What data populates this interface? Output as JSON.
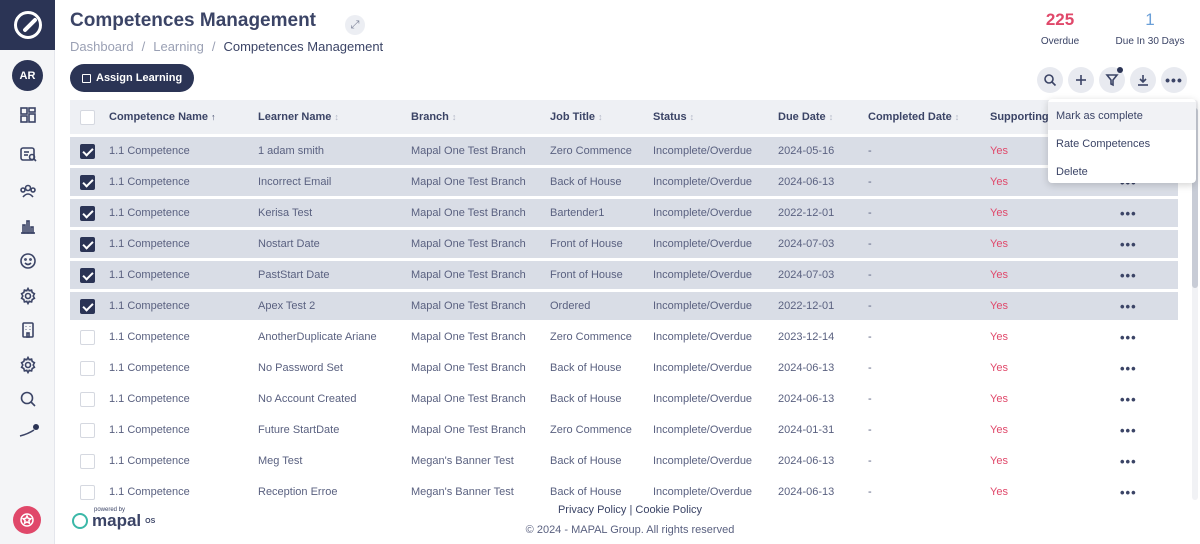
{
  "sidebar": {
    "avatar_initials": "AR"
  },
  "header": {
    "title": "Competences Management",
    "breadcrumb": [
      "Dashboard",
      "Learning",
      "Competences Management"
    ],
    "stats": [
      {
        "value": "225",
        "label": "Overdue",
        "color": "#e0486a"
      },
      {
        "value": "1",
        "label": "Due In 30 Days",
        "color": "#6a9fd8"
      }
    ]
  },
  "toolbar": {
    "assign_label": "Assign Learning",
    "more_label": "•••"
  },
  "table": {
    "columns": [
      "Competence Name",
      "Learner Name",
      "Branch",
      "Job Title",
      "Status",
      "Due Date",
      "Completed Date",
      "Supporting"
    ],
    "rows": [
      {
        "selected": true,
        "cells": [
          "1.1 Competence",
          "1 adam smith",
          "Mapal One Test Branch",
          "Zero Commence",
          "Incomplete/Overdue",
          "2024-05-16",
          "-",
          "Yes"
        ]
      },
      {
        "selected": true,
        "cells": [
          "1.1 Competence",
          "Incorrect Email",
          "Mapal One Test Branch",
          "Back of House",
          "Incomplete/Overdue",
          "2024-06-13",
          "-",
          "Yes"
        ]
      },
      {
        "selected": true,
        "cells": [
          "1.1 Competence",
          "Kerisa Test",
          "Mapal One Test Branch",
          "Bartender1",
          "Incomplete/Overdue",
          "2022-12-01",
          "-",
          "Yes"
        ]
      },
      {
        "selected": true,
        "cells": [
          "1.1 Competence",
          "Nostart Date",
          "Mapal One Test Branch",
          "Front of House",
          "Incomplete/Overdue",
          "2024-07-03",
          "-",
          "Yes"
        ]
      },
      {
        "selected": true,
        "cells": [
          "1.1 Competence",
          "PastStart Date",
          "Mapal One Test Branch",
          "Front of House",
          "Incomplete/Overdue",
          "2024-07-03",
          "-",
          "Yes"
        ]
      },
      {
        "selected": true,
        "cells": [
          "1.1 Competence",
          "Apex Test 2",
          "Mapal One Test Branch",
          "Ordered",
          "Incomplete/Overdue",
          "2022-12-01",
          "-",
          "Yes"
        ]
      },
      {
        "selected": false,
        "cells": [
          "1.1 Competence",
          "AnotherDuplicate Ariane",
          "Mapal One Test Branch",
          "Zero Commence",
          "Incomplete/Overdue",
          "2023-12-14",
          "-",
          "Yes"
        ]
      },
      {
        "selected": false,
        "cells": [
          "1.1 Competence",
          "No Password Set",
          "Mapal One Test Branch",
          "Back of House",
          "Incomplete/Overdue",
          "2024-06-13",
          "-",
          "Yes"
        ]
      },
      {
        "selected": false,
        "cells": [
          "1.1 Competence",
          "No Account Created",
          "Mapal One Test Branch",
          "Back of House",
          "Incomplete/Overdue",
          "2024-06-13",
          "-",
          "Yes"
        ]
      },
      {
        "selected": false,
        "cells": [
          "1.1 Competence",
          "Future StartDate",
          "Mapal One Test Branch",
          "Zero Commence",
          "Incomplete/Overdue",
          "2024-01-31",
          "-",
          "Yes"
        ]
      },
      {
        "selected": false,
        "cells": [
          "1.1 Competence",
          "Meg Test",
          "Megan's Banner Test",
          "Back of House",
          "Incomplete/Overdue",
          "2024-06-13",
          "-",
          "Yes"
        ]
      },
      {
        "selected": false,
        "cells": [
          "1.1 Competence",
          "Reception Erroe",
          "Megan's Banner Test",
          "Back of House",
          "Incomplete/Overdue",
          "2024-06-13",
          "-",
          "Yes"
        ]
      }
    ],
    "row_more_label": "•••"
  },
  "dropdown": {
    "items": [
      "Mark as complete",
      "Rate Competences",
      "Delete"
    ]
  },
  "footer": {
    "links": "Privacy Policy | Cookie Policy",
    "copyright": "© 2024 - MAPAL Group. All rights reserved",
    "powered_by": "powered by",
    "brand": "mapal",
    "brand_sup": "OS"
  }
}
